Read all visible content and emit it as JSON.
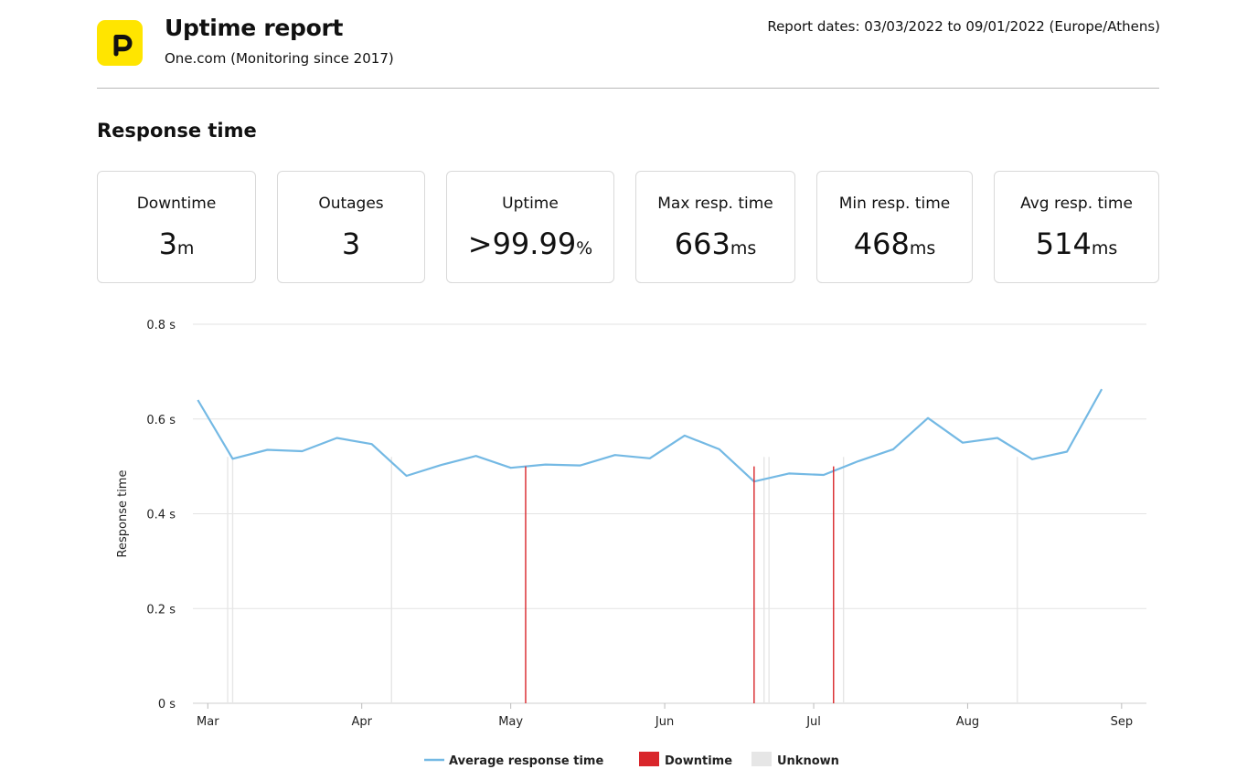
{
  "header": {
    "logo_icon": "p-logo-icon",
    "logo_color": "#ffe500",
    "title": "Uptime report",
    "subtitle": "One.com (Monitoring since 2017)",
    "report_dates": "Report dates: 03/03/2022 to 09/01/2022 (Europe/Athens)"
  },
  "section_title": "Response time",
  "stats": [
    {
      "label": "Downtime",
      "value": "3",
      "unit": "m"
    },
    {
      "label": "Outages",
      "value": "3",
      "unit": ""
    },
    {
      "label": "Uptime",
      "value": ">99.99",
      "unit": "%"
    },
    {
      "label": "Max resp. time",
      "value": "663",
      "unit": "ms"
    },
    {
      "label": "Min resp. time",
      "value": "468",
      "unit": "ms"
    },
    {
      "label": "Avg resp. time",
      "value": "514",
      "unit": "ms"
    }
  ],
  "chart_data": {
    "type": "line",
    "ylabel": "Response time",
    "ylim": [
      0,
      0.8
    ],
    "y_ticks": [
      {
        "value": 0,
        "label": "0 s"
      },
      {
        "value": 0.2,
        "label": "0.2 s"
      },
      {
        "value": 0.4,
        "label": "0.4 s"
      },
      {
        "value": 0.6,
        "label": "0.6 s"
      },
      {
        "value": 0.8,
        "label": "0.8 s"
      }
    ],
    "xlim": [
      "2022-02-26",
      "2022-09-06"
    ],
    "x_ticks": [
      {
        "date": "2022-03-01",
        "label": "Mar"
      },
      {
        "date": "2022-04-01",
        "label": "Apr"
      },
      {
        "date": "2022-05-01",
        "label": "May"
      },
      {
        "date": "2022-06-01",
        "label": "Jun"
      },
      {
        "date": "2022-07-01",
        "label": "Jul"
      },
      {
        "date": "2022-08-01",
        "label": "Aug"
      },
      {
        "date": "2022-09-01",
        "label": "Sep"
      }
    ],
    "grid": true,
    "legend_position": "bottom",
    "legend": [
      {
        "label": "Average response time",
        "symbol": "line",
        "color": "#74b9e4"
      },
      {
        "label": "Downtime",
        "symbol": "box",
        "color": "#d9262b"
      },
      {
        "label": "Unknown",
        "symbol": "box",
        "color": "#e6e6e6"
      }
    ],
    "series": [
      {
        "name": "Average response time",
        "color": "#74b9e4",
        "points": [
          {
            "x": "2022-02-27",
            "y": 0.64
          },
          {
            "x": "2022-03-06",
            "y": 0.516
          },
          {
            "x": "2022-03-13",
            "y": 0.535
          },
          {
            "x": "2022-03-20",
            "y": 0.532
          },
          {
            "x": "2022-03-27",
            "y": 0.56
          },
          {
            "x": "2022-04-03",
            "y": 0.547
          },
          {
            "x": "2022-04-10",
            "y": 0.48
          },
          {
            "x": "2022-04-17",
            "y": 0.503
          },
          {
            "x": "2022-04-24",
            "y": 0.522
          },
          {
            "x": "2022-05-01",
            "y": 0.497
          },
          {
            "x": "2022-05-08",
            "y": 0.504
          },
          {
            "x": "2022-05-15",
            "y": 0.502
          },
          {
            "x": "2022-05-22",
            "y": 0.524
          },
          {
            "x": "2022-05-29",
            "y": 0.517
          },
          {
            "x": "2022-06-05",
            "y": 0.565
          },
          {
            "x": "2022-06-12",
            "y": 0.536
          },
          {
            "x": "2022-06-19",
            "y": 0.468
          },
          {
            "x": "2022-06-26",
            "y": 0.485
          },
          {
            "x": "2022-07-03",
            "y": 0.482
          },
          {
            "x": "2022-07-10",
            "y": 0.511
          },
          {
            "x": "2022-07-17",
            "y": 0.536
          },
          {
            "x": "2022-07-24",
            "y": 0.602
          },
          {
            "x": "2022-07-31",
            "y": 0.55
          },
          {
            "x": "2022-08-07",
            "y": 0.56
          },
          {
            "x": "2022-08-14",
            "y": 0.515
          },
          {
            "x": "2022-08-21",
            "y": 0.531
          },
          {
            "x": "2022-08-28",
            "y": 0.663
          }
        ]
      }
    ],
    "downtime_markers": [
      "2022-05-04",
      "2022-06-19",
      "2022-07-05"
    ],
    "unknown_markers": [
      "2022-03-05",
      "2022-03-06",
      "2022-04-07",
      "2022-06-21",
      "2022-06-22",
      "2022-07-07",
      "2022-08-11"
    ]
  }
}
